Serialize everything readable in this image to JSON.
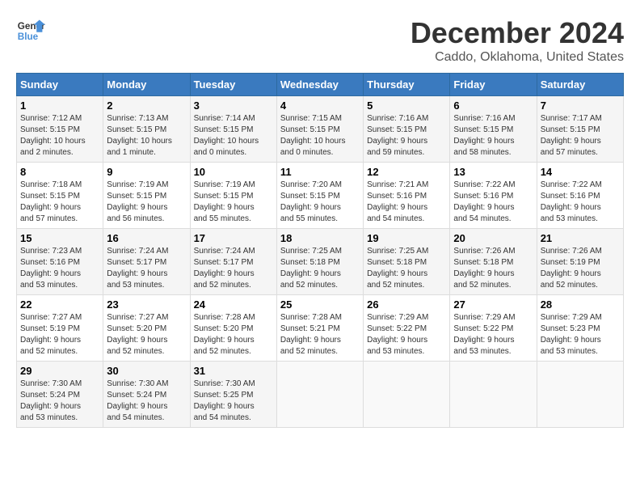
{
  "logo": {
    "line1": "General",
    "line2": "Blue"
  },
  "title": "December 2024",
  "subtitle": "Caddo, Oklahoma, United States",
  "days_of_week": [
    "Sunday",
    "Monday",
    "Tuesday",
    "Wednesday",
    "Thursday",
    "Friday",
    "Saturday"
  ],
  "weeks": [
    [
      {
        "day": "1",
        "info": "Sunrise: 7:12 AM\nSunset: 5:15 PM\nDaylight: 10 hours\nand 2 minutes."
      },
      {
        "day": "2",
        "info": "Sunrise: 7:13 AM\nSunset: 5:15 PM\nDaylight: 10 hours\nand 1 minute."
      },
      {
        "day": "3",
        "info": "Sunrise: 7:14 AM\nSunset: 5:15 PM\nDaylight: 10 hours\nand 0 minutes."
      },
      {
        "day": "4",
        "info": "Sunrise: 7:15 AM\nSunset: 5:15 PM\nDaylight: 10 hours\nand 0 minutes."
      },
      {
        "day": "5",
        "info": "Sunrise: 7:16 AM\nSunset: 5:15 PM\nDaylight: 9 hours\nand 59 minutes."
      },
      {
        "day": "6",
        "info": "Sunrise: 7:16 AM\nSunset: 5:15 PM\nDaylight: 9 hours\nand 58 minutes."
      },
      {
        "day": "7",
        "info": "Sunrise: 7:17 AM\nSunset: 5:15 PM\nDaylight: 9 hours\nand 57 minutes."
      }
    ],
    [
      {
        "day": "8",
        "info": "Sunrise: 7:18 AM\nSunset: 5:15 PM\nDaylight: 9 hours\nand 57 minutes."
      },
      {
        "day": "9",
        "info": "Sunrise: 7:19 AM\nSunset: 5:15 PM\nDaylight: 9 hours\nand 56 minutes."
      },
      {
        "day": "10",
        "info": "Sunrise: 7:19 AM\nSunset: 5:15 PM\nDaylight: 9 hours\nand 55 minutes."
      },
      {
        "day": "11",
        "info": "Sunrise: 7:20 AM\nSunset: 5:15 PM\nDaylight: 9 hours\nand 55 minutes."
      },
      {
        "day": "12",
        "info": "Sunrise: 7:21 AM\nSunset: 5:16 PM\nDaylight: 9 hours\nand 54 minutes."
      },
      {
        "day": "13",
        "info": "Sunrise: 7:22 AM\nSunset: 5:16 PM\nDaylight: 9 hours\nand 54 minutes."
      },
      {
        "day": "14",
        "info": "Sunrise: 7:22 AM\nSunset: 5:16 PM\nDaylight: 9 hours\nand 53 minutes."
      }
    ],
    [
      {
        "day": "15",
        "info": "Sunrise: 7:23 AM\nSunset: 5:16 PM\nDaylight: 9 hours\nand 53 minutes."
      },
      {
        "day": "16",
        "info": "Sunrise: 7:24 AM\nSunset: 5:17 PM\nDaylight: 9 hours\nand 53 minutes."
      },
      {
        "day": "17",
        "info": "Sunrise: 7:24 AM\nSunset: 5:17 PM\nDaylight: 9 hours\nand 52 minutes."
      },
      {
        "day": "18",
        "info": "Sunrise: 7:25 AM\nSunset: 5:18 PM\nDaylight: 9 hours\nand 52 minutes."
      },
      {
        "day": "19",
        "info": "Sunrise: 7:25 AM\nSunset: 5:18 PM\nDaylight: 9 hours\nand 52 minutes."
      },
      {
        "day": "20",
        "info": "Sunrise: 7:26 AM\nSunset: 5:18 PM\nDaylight: 9 hours\nand 52 minutes."
      },
      {
        "day": "21",
        "info": "Sunrise: 7:26 AM\nSunset: 5:19 PM\nDaylight: 9 hours\nand 52 minutes."
      }
    ],
    [
      {
        "day": "22",
        "info": "Sunrise: 7:27 AM\nSunset: 5:19 PM\nDaylight: 9 hours\nand 52 minutes."
      },
      {
        "day": "23",
        "info": "Sunrise: 7:27 AM\nSunset: 5:20 PM\nDaylight: 9 hours\nand 52 minutes."
      },
      {
        "day": "24",
        "info": "Sunrise: 7:28 AM\nSunset: 5:20 PM\nDaylight: 9 hours\nand 52 minutes."
      },
      {
        "day": "25",
        "info": "Sunrise: 7:28 AM\nSunset: 5:21 PM\nDaylight: 9 hours\nand 52 minutes."
      },
      {
        "day": "26",
        "info": "Sunrise: 7:29 AM\nSunset: 5:22 PM\nDaylight: 9 hours\nand 53 minutes."
      },
      {
        "day": "27",
        "info": "Sunrise: 7:29 AM\nSunset: 5:22 PM\nDaylight: 9 hours\nand 53 minutes."
      },
      {
        "day": "28",
        "info": "Sunrise: 7:29 AM\nSunset: 5:23 PM\nDaylight: 9 hours\nand 53 minutes."
      }
    ],
    [
      {
        "day": "29",
        "info": "Sunrise: 7:30 AM\nSunset: 5:24 PM\nDaylight: 9 hours\nand 53 minutes."
      },
      {
        "day": "30",
        "info": "Sunrise: 7:30 AM\nSunset: 5:24 PM\nDaylight: 9 hours\nand 54 minutes."
      },
      {
        "day": "31",
        "info": "Sunrise: 7:30 AM\nSunset: 5:25 PM\nDaylight: 9 hours\nand 54 minutes."
      },
      {
        "day": "",
        "info": ""
      },
      {
        "day": "",
        "info": ""
      },
      {
        "day": "",
        "info": ""
      },
      {
        "day": "",
        "info": ""
      }
    ]
  ]
}
